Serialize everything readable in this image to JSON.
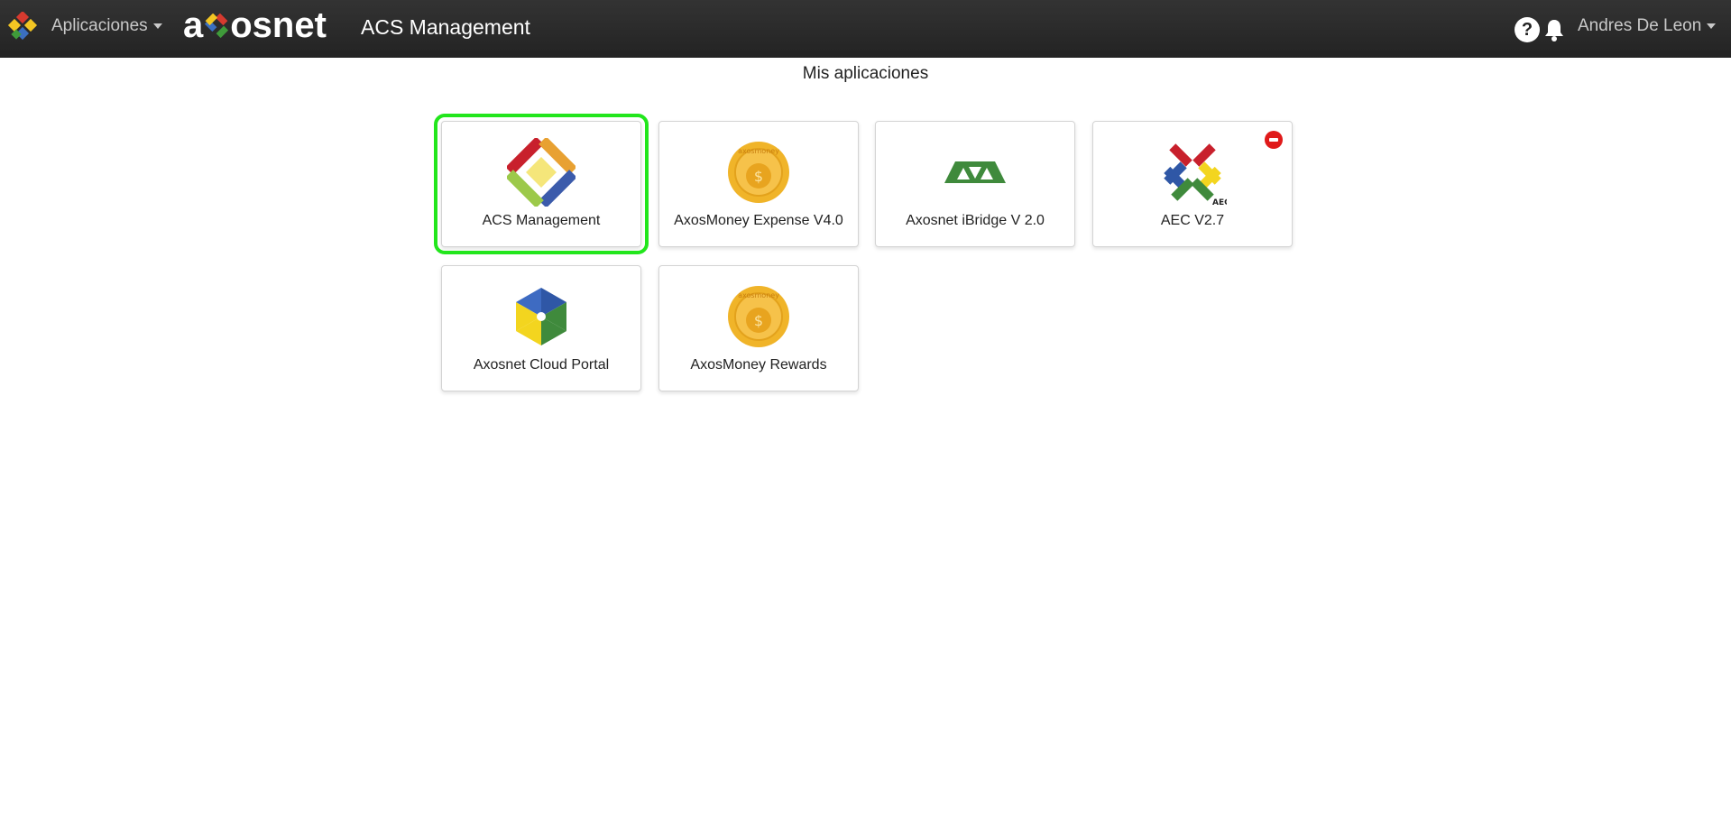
{
  "header": {
    "apps_menu_label": "Aplicaciones",
    "brand": "axosnet",
    "app_title": "ACS Management",
    "help_label": "?",
    "user_name": "Andres De Leon"
  },
  "main": {
    "section_title": "Mis aplicaciones",
    "apps": [
      {
        "label": "ACS Management",
        "icon": "acs-management-icon",
        "selected": true
      },
      {
        "label": "AxosMoney Expense V4.0",
        "icon": "axosmoney-coin-icon"
      },
      {
        "label": "Axosnet iBridge V 2.0",
        "icon": "ibridge-icon"
      },
      {
        "label": "AEC V2.7",
        "icon": "aec-icon",
        "badge": "remove-badge-icon"
      },
      {
        "label": "Axosnet Cloud Portal",
        "icon": "cloud-portal-icon"
      },
      {
        "label": "AxosMoney Rewards",
        "icon": "axosmoney-coin-icon"
      }
    ],
    "coin_text": "axosmoney",
    "coin_symbol": "$",
    "aec_icon_text": "AEC"
  },
  "colors": {
    "topbar": "#2b2b2b",
    "selected_outline": "#22e61c",
    "badge": "#e01a1a"
  }
}
